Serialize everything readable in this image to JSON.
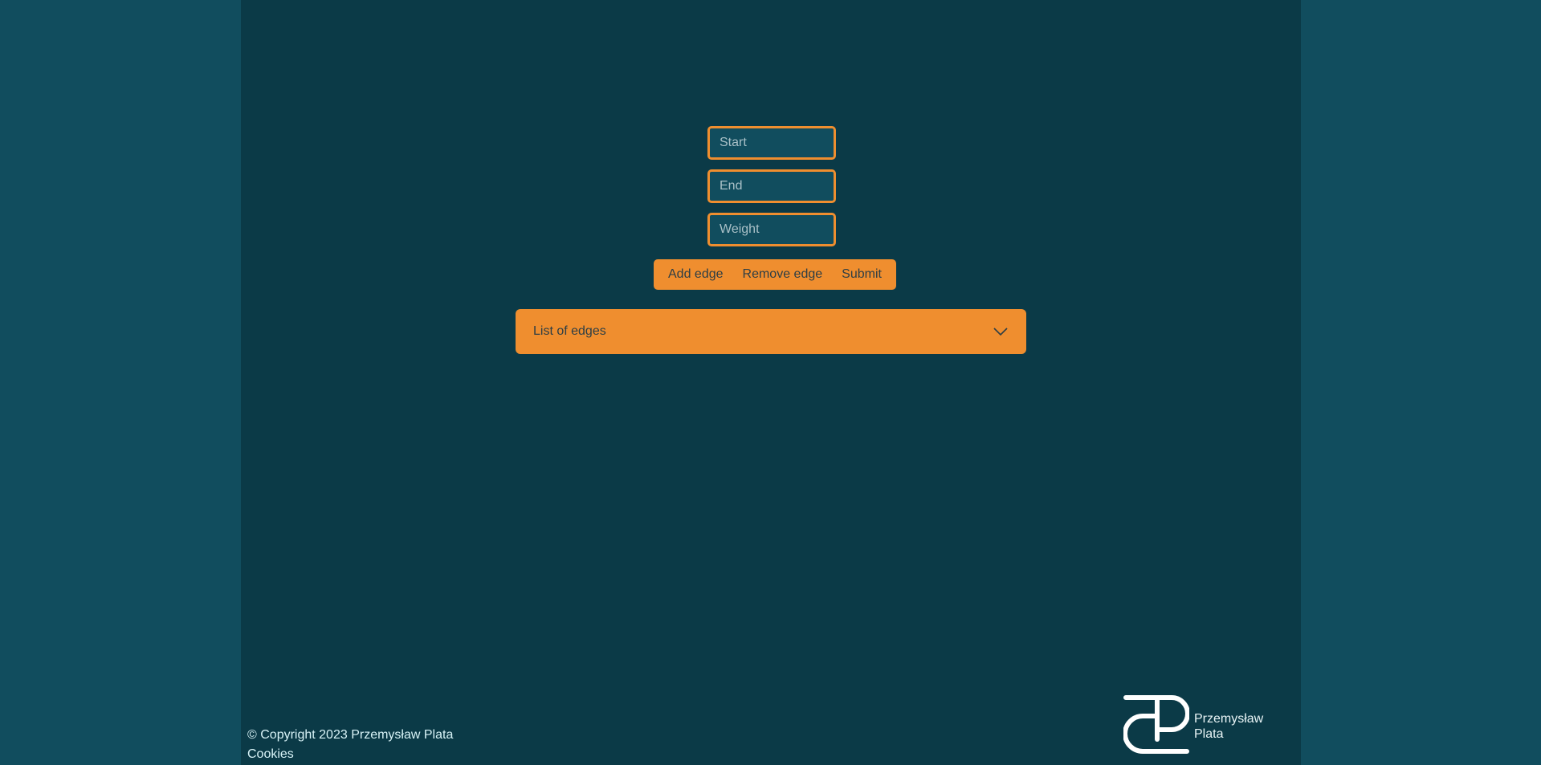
{
  "form": {
    "start_placeholder": "Start",
    "end_placeholder": "End",
    "weight_placeholder": "Weight"
  },
  "actions": {
    "add_edge": "Add edge",
    "remove_edge": "Remove edge",
    "submit": "Submit"
  },
  "accordion": {
    "label": "List of edges",
    "icon": "chevron-down-icon"
  },
  "footer": {
    "copyright": "© Copyright 2023 Przemysław Plata",
    "cookies": "Cookies"
  },
  "logo": {
    "line1": "Przemysław",
    "line2": "Plata",
    "icon": "pp-monogram-logo"
  },
  "colors": {
    "outer_background": "#114d5e",
    "page_background": "#0b3a47",
    "accent": "#ef8e2f"
  }
}
